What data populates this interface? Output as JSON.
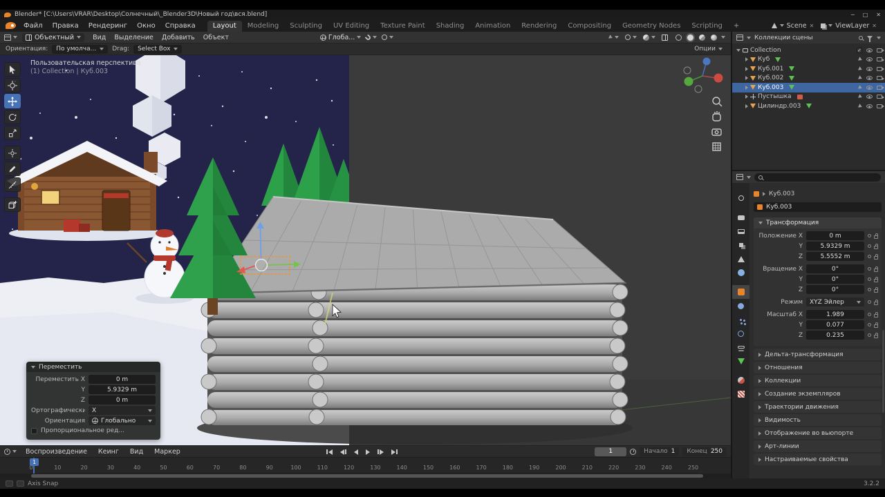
{
  "window": {
    "title": "Blender* [C:\\Users\\VRAR\\Desktop\\Солнечный\\_Blender3D\\Новый год\\вся.blend]"
  },
  "colors": {
    "accent": "#4772b3",
    "orange": "#e8842c",
    "selected_row": "#3e66a0",
    "mesh_green": "#5fc254"
  },
  "top_bar": {
    "menus": [
      "Файл",
      "Правка",
      "Рендеринг",
      "Окно",
      "Справка"
    ],
    "workspaces": [
      "Layout",
      "Modeling",
      "Sculpting",
      "UV Editing",
      "Texture Paint",
      "Shading",
      "Animation",
      "Rendering",
      "Compositing",
      "Geometry Nodes",
      "Scripting"
    ],
    "active_workspace": "Layout",
    "add_workspace_label": "+",
    "scene_label": "Scene",
    "viewlayer_label": "ViewLayer"
  },
  "viewport_header": {
    "mode": "Объектный",
    "menus": [
      "Вид",
      "Выделение",
      "Добавить",
      "Объект"
    ],
    "orientation": "Глоба..."
  },
  "tool_settings": {
    "orientation_label": "Ориентация:",
    "orientation_value": "По умолча...",
    "drag_label": "Drag:",
    "drag_value": "Select Box",
    "options_label": "Опции"
  },
  "toolbar": {
    "tools": [
      {
        "id": "tweak",
        "name": "select-box-tool"
      },
      {
        "id": "cursor",
        "name": "cursor-tool"
      },
      {
        "id": "move",
        "name": "move-tool",
        "active": true
      },
      {
        "id": "rotate",
        "name": "rotate-tool"
      },
      {
        "id": "scale",
        "name": "scale-tool"
      },
      {
        "id": "transform",
        "name": "transform-tool",
        "gap": true
      },
      {
        "id": "annotate",
        "name": "annotate-tool"
      },
      {
        "id": "measure",
        "name": "measure-tool"
      },
      {
        "id": "add-cube",
        "name": "add-cube-tool",
        "gap": true
      }
    ]
  },
  "viewport": {
    "overlay_title": "Пользовательская перспектива",
    "overlay_subtitle": "(1) Collection | Куб.003"
  },
  "move_panel": {
    "title": "Переместить",
    "fields": [
      {
        "label": "Переместить X",
        "value": "0 m"
      },
      {
        "label": "Y",
        "value": "5.9329 m"
      },
      {
        "label": "Z",
        "value": "0 m"
      }
    ],
    "ortho_label": "Ортографически...",
    "ortho_value": "X",
    "orientation_label": "Ориентация",
    "orientation_value": "Глобально",
    "proportional_label": "Пропорциональное ред..."
  },
  "timeline": {
    "menus": [
      "Воспроизведение",
      "Кеинг",
      "Вид",
      "Маркер"
    ],
    "transport": [
      "jump-to-start",
      "jump-to-prev-keyframe",
      "play-reverse",
      "play",
      "jump-to-next-keyframe",
      "jump-to-end"
    ],
    "current_frame": "1",
    "start_label": "Начало",
    "start_value": "1",
    "end_label": "Конец",
    "end_value": "250",
    "ticks": [
      "0",
      "10",
      "20",
      "30",
      "40",
      "50",
      "60",
      "70",
      "80",
      "90",
      "100",
      "110",
      "120",
      "130",
      "140",
      "150",
      "160",
      "170",
      "180",
      "190",
      "200",
      "210",
      "220",
      "230",
      "240",
      "250"
    ]
  },
  "outliner": {
    "header_label": "Коллекции сцены",
    "rows": [
      {
        "label": "Collection",
        "depth": 0,
        "icon": "collection",
        "expanded": true,
        "checkbox": true
      },
      {
        "label": "Куб",
        "depth": 1,
        "icon": "mesh-object",
        "data_icon": "mesh-data"
      },
      {
        "label": "Куб.001",
        "depth": 1,
        "icon": "mesh-object",
        "data_icon": "mesh-data"
      },
      {
        "label": "Куб.002",
        "depth": 1,
        "icon": "mesh-object",
        "data_icon": "mesh-data"
      },
      {
        "label": "Куб.003",
        "depth": 1,
        "icon": "mesh-object",
        "data_icon": "mesh-data",
        "selected": true
      },
      {
        "label": "Пустышка",
        "depth": 1,
        "icon": "empty-object",
        "data_icon": "image-data"
      },
      {
        "label": "Цилиндр.003",
        "depth": 1,
        "icon": "mesh-object",
        "data_icon": "mesh-data"
      }
    ]
  },
  "properties": {
    "tabs": [
      "tool",
      "render",
      "output",
      "view-layer",
      "scene",
      "world",
      "object",
      "modifiers",
      "particles",
      "physics",
      "constraints",
      "object-data",
      "material",
      "texture"
    ],
    "active_tab": "object",
    "breadcrumb": "Куб.003",
    "name_value": "Куб.003",
    "transform_label": "Трансформация",
    "fields": [
      {
        "label": "Положение X",
        "value": "0 m"
      },
      {
        "label": "Y",
        "value": "5.9329 m"
      },
      {
        "label": "Z",
        "value": "5.5552 m"
      },
      {
        "label": "Вращение X",
        "value": "0°",
        "gap": true
      },
      {
        "label": "Y",
        "value": "0°"
      },
      {
        "label": "Z",
        "value": "0°"
      },
      {
        "label": "Режим",
        "value": "XYZ Эйлер",
        "dropdown": true,
        "gap": true
      },
      {
        "label": "Масштаб X",
        "value": "1.989",
        "gap": true
      },
      {
        "label": "Y",
        "value": "0.077"
      },
      {
        "label": "Z",
        "value": "0.235"
      }
    ],
    "sections": [
      "Дельта-трансформация",
      "Отношения",
      "Коллекции",
      "Создание экземпляров",
      "Траектории движения",
      "Видимость",
      "Отображение во вьюпорте",
      "Арт-линии",
      "Настраиваемые свойства"
    ]
  },
  "status_bar": {
    "left": "Axis Snap",
    "version": "3.2.2"
  }
}
